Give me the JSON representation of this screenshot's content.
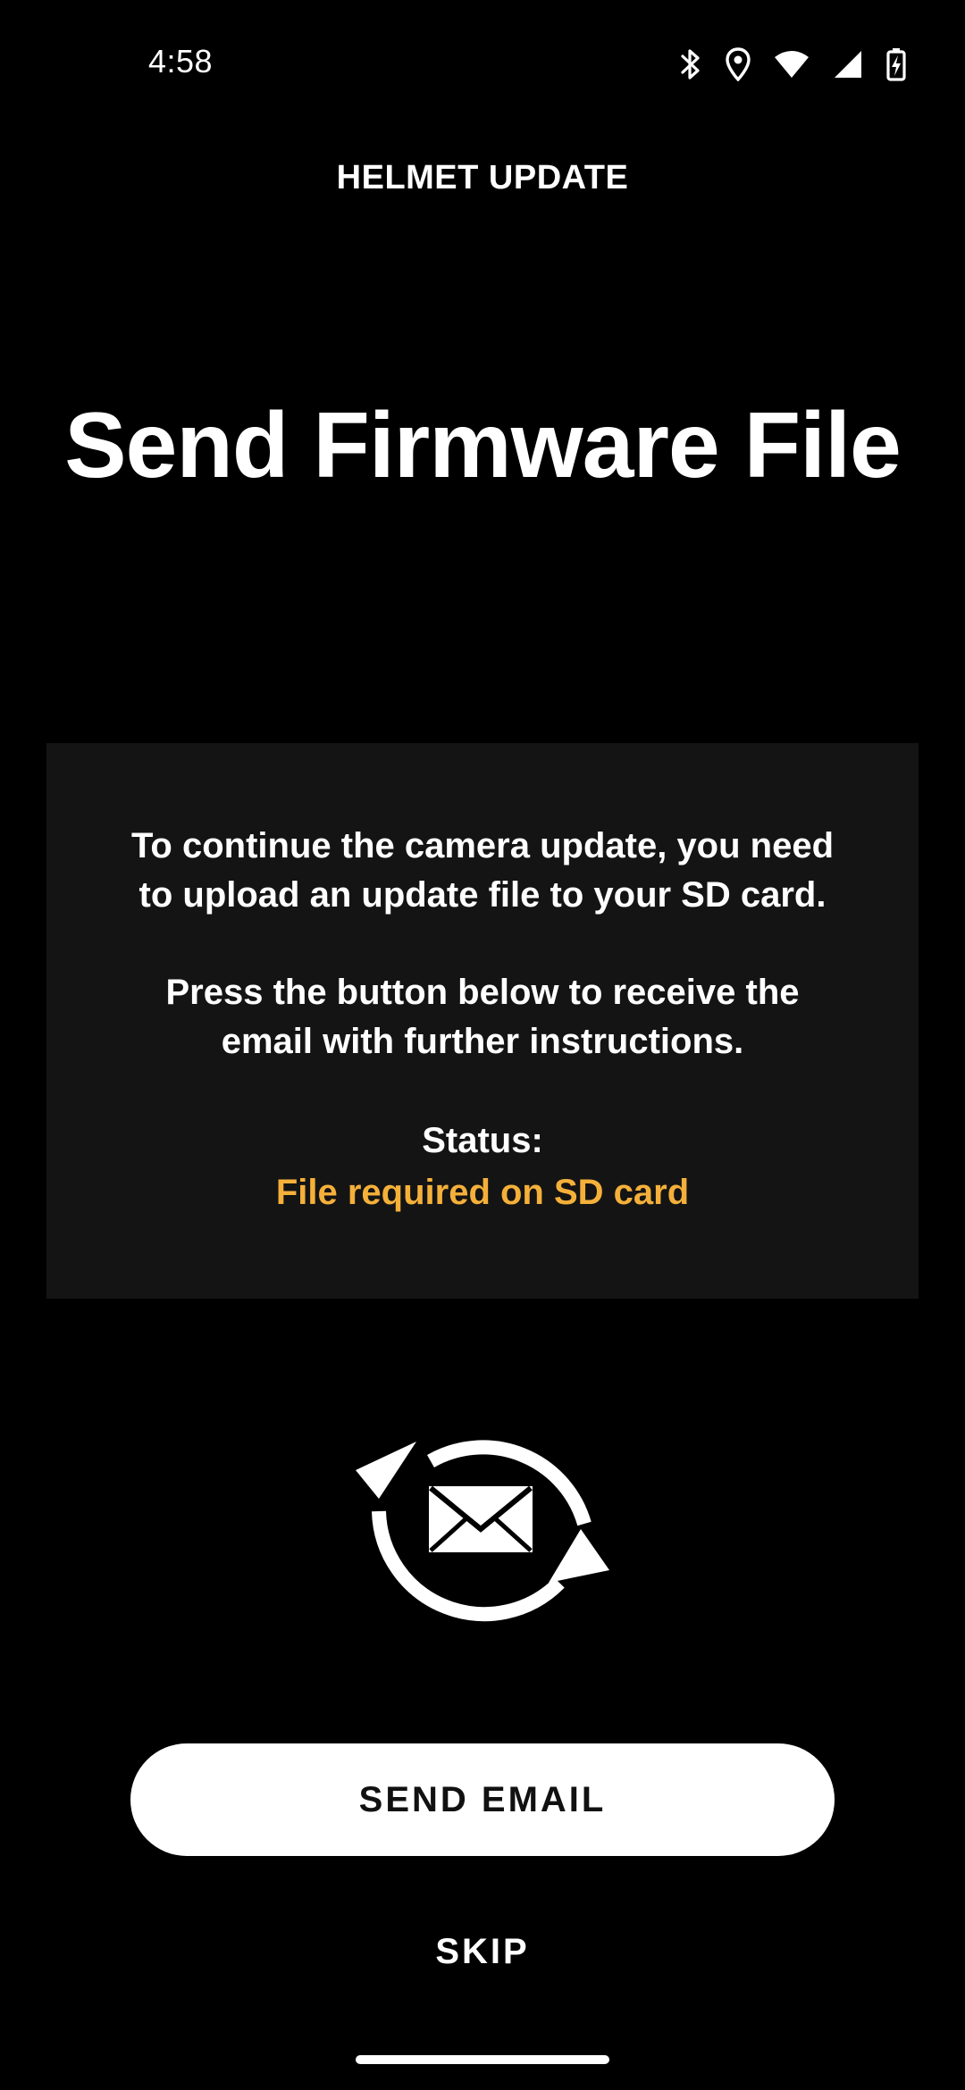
{
  "status_bar": {
    "time": "4:58",
    "icons": [
      "bluetooth-icon",
      "location-icon",
      "wifi-icon",
      "signal-icon",
      "battery-charging-icon"
    ]
  },
  "header": {
    "title": "HELMET UPDATE"
  },
  "main": {
    "headline": "Send Firmware File",
    "info": {
      "paragraph_1": {
        "line_1": "To continue the camera update, you need",
        "line_2": "to upload an update file to your SD card."
      },
      "paragraph_2": {
        "line_1": "Press the button below to receive the",
        "line_2": "email with further instructions."
      },
      "status_label": "Status:",
      "status_value": "File required on SD card"
    },
    "hero_icon": "email-sync-icon"
  },
  "actions": {
    "send_email_label": "SEND EMAIL",
    "skip_label": "SKIP"
  },
  "colors": {
    "background": "#000000",
    "card": "#141414",
    "status_accent": "#F5B03A",
    "button": "#FFFFFF"
  }
}
